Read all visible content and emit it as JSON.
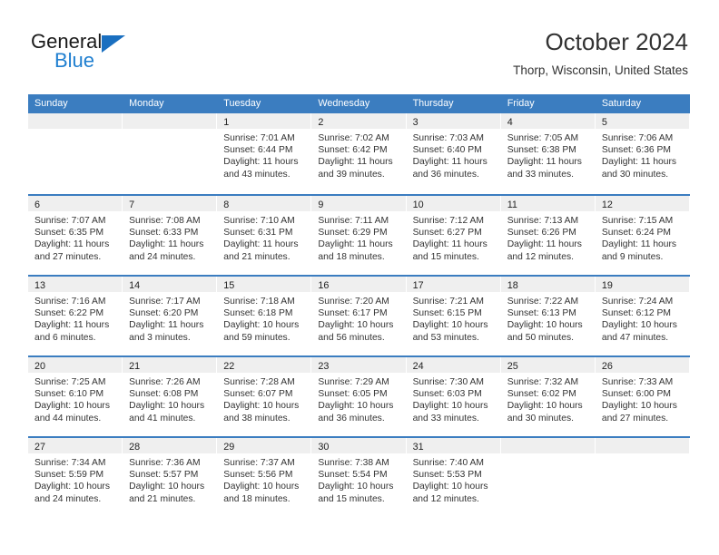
{
  "brand": {
    "name_top": "General",
    "name_bottom": "Blue",
    "triangle_icon": "triangle-icon",
    "color_dark": "#1a1a1a",
    "color_blue": "#1f7fd0"
  },
  "header": {
    "title": "October 2024",
    "subtitle": "Thorp, Wisconsin, United States"
  },
  "theme": {
    "header_blue": "#3b7dc0",
    "band_gray": "#efefef",
    "text": "#333333"
  },
  "weekday_headers": [
    "Sunday",
    "Monday",
    "Tuesday",
    "Wednesday",
    "Thursday",
    "Friday",
    "Saturday"
  ],
  "weeks": [
    {
      "days": [
        {
          "num": "",
          "empty": true,
          "sunrise": "",
          "sunset": "",
          "daylight_1": "",
          "daylight_2": ""
        },
        {
          "num": "",
          "empty": true,
          "sunrise": "",
          "sunset": "",
          "daylight_1": "",
          "daylight_2": ""
        },
        {
          "num": "1",
          "empty": false,
          "sunrise": "Sunrise: 7:01 AM",
          "sunset": "Sunset: 6:44 PM",
          "daylight_1": "Daylight: 11 hours",
          "daylight_2": "and 43 minutes."
        },
        {
          "num": "2",
          "empty": false,
          "sunrise": "Sunrise: 7:02 AM",
          "sunset": "Sunset: 6:42 PM",
          "daylight_1": "Daylight: 11 hours",
          "daylight_2": "and 39 minutes."
        },
        {
          "num": "3",
          "empty": false,
          "sunrise": "Sunrise: 7:03 AM",
          "sunset": "Sunset: 6:40 PM",
          "daylight_1": "Daylight: 11 hours",
          "daylight_2": "and 36 minutes."
        },
        {
          "num": "4",
          "empty": false,
          "sunrise": "Sunrise: 7:05 AM",
          "sunset": "Sunset: 6:38 PM",
          "daylight_1": "Daylight: 11 hours",
          "daylight_2": "and 33 minutes."
        },
        {
          "num": "5",
          "empty": false,
          "sunrise": "Sunrise: 7:06 AM",
          "sunset": "Sunset: 6:36 PM",
          "daylight_1": "Daylight: 11 hours",
          "daylight_2": "and 30 minutes."
        }
      ]
    },
    {
      "days": [
        {
          "num": "6",
          "empty": false,
          "sunrise": "Sunrise: 7:07 AM",
          "sunset": "Sunset: 6:35 PM",
          "daylight_1": "Daylight: 11 hours",
          "daylight_2": "and 27 minutes."
        },
        {
          "num": "7",
          "empty": false,
          "sunrise": "Sunrise: 7:08 AM",
          "sunset": "Sunset: 6:33 PM",
          "daylight_1": "Daylight: 11 hours",
          "daylight_2": "and 24 minutes."
        },
        {
          "num": "8",
          "empty": false,
          "sunrise": "Sunrise: 7:10 AM",
          "sunset": "Sunset: 6:31 PM",
          "daylight_1": "Daylight: 11 hours",
          "daylight_2": "and 21 minutes."
        },
        {
          "num": "9",
          "empty": false,
          "sunrise": "Sunrise: 7:11 AM",
          "sunset": "Sunset: 6:29 PM",
          "daylight_1": "Daylight: 11 hours",
          "daylight_2": "and 18 minutes."
        },
        {
          "num": "10",
          "empty": false,
          "sunrise": "Sunrise: 7:12 AM",
          "sunset": "Sunset: 6:27 PM",
          "daylight_1": "Daylight: 11 hours",
          "daylight_2": "and 15 minutes."
        },
        {
          "num": "11",
          "empty": false,
          "sunrise": "Sunrise: 7:13 AM",
          "sunset": "Sunset: 6:26 PM",
          "daylight_1": "Daylight: 11 hours",
          "daylight_2": "and 12 minutes."
        },
        {
          "num": "12",
          "empty": false,
          "sunrise": "Sunrise: 7:15 AM",
          "sunset": "Sunset: 6:24 PM",
          "daylight_1": "Daylight: 11 hours",
          "daylight_2": "and 9 minutes."
        }
      ]
    },
    {
      "days": [
        {
          "num": "13",
          "empty": false,
          "sunrise": "Sunrise: 7:16 AM",
          "sunset": "Sunset: 6:22 PM",
          "daylight_1": "Daylight: 11 hours",
          "daylight_2": "and 6 minutes."
        },
        {
          "num": "14",
          "empty": false,
          "sunrise": "Sunrise: 7:17 AM",
          "sunset": "Sunset: 6:20 PM",
          "daylight_1": "Daylight: 11 hours",
          "daylight_2": "and 3 minutes."
        },
        {
          "num": "15",
          "empty": false,
          "sunrise": "Sunrise: 7:18 AM",
          "sunset": "Sunset: 6:18 PM",
          "daylight_1": "Daylight: 10 hours",
          "daylight_2": "and 59 minutes."
        },
        {
          "num": "16",
          "empty": false,
          "sunrise": "Sunrise: 7:20 AM",
          "sunset": "Sunset: 6:17 PM",
          "daylight_1": "Daylight: 10 hours",
          "daylight_2": "and 56 minutes."
        },
        {
          "num": "17",
          "empty": false,
          "sunrise": "Sunrise: 7:21 AM",
          "sunset": "Sunset: 6:15 PM",
          "daylight_1": "Daylight: 10 hours",
          "daylight_2": "and 53 minutes."
        },
        {
          "num": "18",
          "empty": false,
          "sunrise": "Sunrise: 7:22 AM",
          "sunset": "Sunset: 6:13 PM",
          "daylight_1": "Daylight: 10 hours",
          "daylight_2": "and 50 minutes."
        },
        {
          "num": "19",
          "empty": false,
          "sunrise": "Sunrise: 7:24 AM",
          "sunset": "Sunset: 6:12 PM",
          "daylight_1": "Daylight: 10 hours",
          "daylight_2": "and 47 minutes."
        }
      ]
    },
    {
      "days": [
        {
          "num": "20",
          "empty": false,
          "sunrise": "Sunrise: 7:25 AM",
          "sunset": "Sunset: 6:10 PM",
          "daylight_1": "Daylight: 10 hours",
          "daylight_2": "and 44 minutes."
        },
        {
          "num": "21",
          "empty": false,
          "sunrise": "Sunrise: 7:26 AM",
          "sunset": "Sunset: 6:08 PM",
          "daylight_1": "Daylight: 10 hours",
          "daylight_2": "and 41 minutes."
        },
        {
          "num": "22",
          "empty": false,
          "sunrise": "Sunrise: 7:28 AM",
          "sunset": "Sunset: 6:07 PM",
          "daylight_1": "Daylight: 10 hours",
          "daylight_2": "and 38 minutes."
        },
        {
          "num": "23",
          "empty": false,
          "sunrise": "Sunrise: 7:29 AM",
          "sunset": "Sunset: 6:05 PM",
          "daylight_1": "Daylight: 10 hours",
          "daylight_2": "and 36 minutes."
        },
        {
          "num": "24",
          "empty": false,
          "sunrise": "Sunrise: 7:30 AM",
          "sunset": "Sunset: 6:03 PM",
          "daylight_1": "Daylight: 10 hours",
          "daylight_2": "and 33 minutes."
        },
        {
          "num": "25",
          "empty": false,
          "sunrise": "Sunrise: 7:32 AM",
          "sunset": "Sunset: 6:02 PM",
          "daylight_1": "Daylight: 10 hours",
          "daylight_2": "and 30 minutes."
        },
        {
          "num": "26",
          "empty": false,
          "sunrise": "Sunrise: 7:33 AM",
          "sunset": "Sunset: 6:00 PM",
          "daylight_1": "Daylight: 10 hours",
          "daylight_2": "and 27 minutes."
        }
      ]
    },
    {
      "days": [
        {
          "num": "27",
          "empty": false,
          "sunrise": "Sunrise: 7:34 AM",
          "sunset": "Sunset: 5:59 PM",
          "daylight_1": "Daylight: 10 hours",
          "daylight_2": "and 24 minutes."
        },
        {
          "num": "28",
          "empty": false,
          "sunrise": "Sunrise: 7:36 AM",
          "sunset": "Sunset: 5:57 PM",
          "daylight_1": "Daylight: 10 hours",
          "daylight_2": "and 21 minutes."
        },
        {
          "num": "29",
          "empty": false,
          "sunrise": "Sunrise: 7:37 AM",
          "sunset": "Sunset: 5:56 PM",
          "daylight_1": "Daylight: 10 hours",
          "daylight_2": "and 18 minutes."
        },
        {
          "num": "30",
          "empty": false,
          "sunrise": "Sunrise: 7:38 AM",
          "sunset": "Sunset: 5:54 PM",
          "daylight_1": "Daylight: 10 hours",
          "daylight_2": "and 15 minutes."
        },
        {
          "num": "31",
          "empty": false,
          "sunrise": "Sunrise: 7:40 AM",
          "sunset": "Sunset: 5:53 PM",
          "daylight_1": "Daylight: 10 hours",
          "daylight_2": "and 12 minutes."
        },
        {
          "num": "",
          "empty": true,
          "sunrise": "",
          "sunset": "",
          "daylight_1": "",
          "daylight_2": ""
        },
        {
          "num": "",
          "empty": true,
          "sunrise": "",
          "sunset": "",
          "daylight_1": "",
          "daylight_2": ""
        }
      ]
    }
  ]
}
